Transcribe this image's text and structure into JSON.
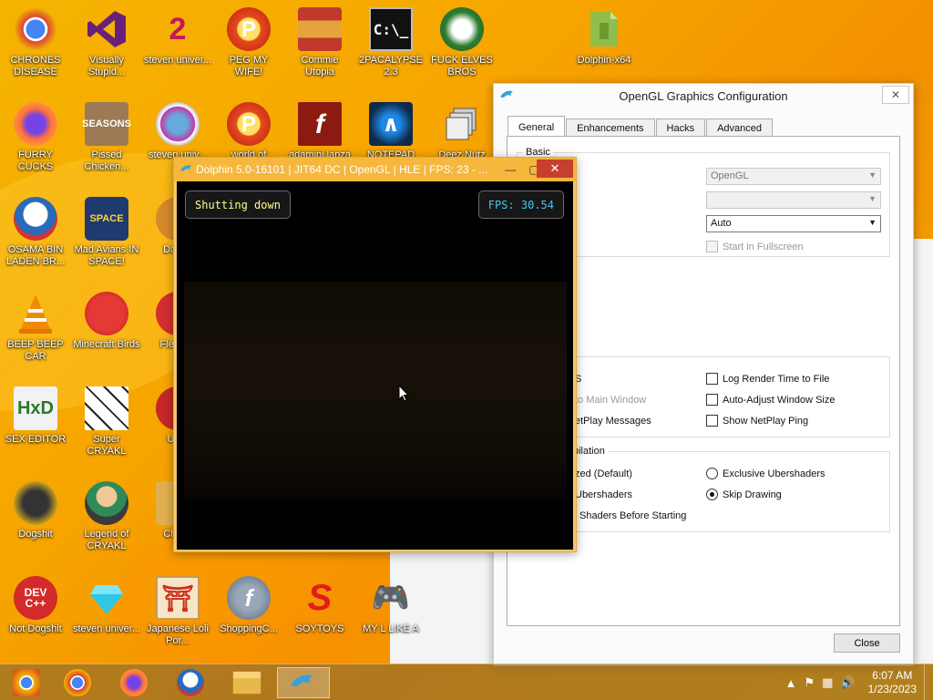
{
  "desktop": {
    "icons": [
      {
        "label": "CHRONES DISEASE",
        "icon": "chrome-icon"
      },
      {
        "label": "Visually Stupid...",
        "icon": "visual-studio-icon"
      },
      {
        "label": "steven univer...",
        "icon": "app-icon"
      },
      {
        "label": "PEG MY WIFE!",
        "icon": "peggle-icon"
      },
      {
        "label": "Commie Utopia",
        "icon": "game-icon"
      },
      {
        "label": "2PACALYPSE 2.3",
        "icon": "console-icon"
      },
      {
        "label": "FUCK ELVES BROS",
        "icon": "game-icon"
      },
      {
        "label": "Dolphin-x64",
        "icon": "folder-icon"
      },
      {
        "label": "FURRY CUCKS",
        "icon": "firefox-icon"
      },
      {
        "label": "Pissed Chicken...",
        "icon": "angry-birds-icon"
      },
      {
        "label": "steven univ...",
        "icon": "gem-icon"
      },
      {
        "label": "world of",
        "icon": "peggle-icon"
      },
      {
        "label": "adamini lanza",
        "icon": "flash-icon"
      },
      {
        "label": "NOTEPAD",
        "icon": "notepad-icon"
      },
      {
        "label": "Deez Nutz",
        "icon": "windows-icon"
      },
      {
        "label": "OSAMA BIN LADEN BR...",
        "icon": "obama-logo-icon"
      },
      {
        "label": "Mad Avians IN SPACE!",
        "icon": "angry-birds-space-icon"
      },
      {
        "label": "DarkO",
        "icon": "app-icon"
      },
      {
        "label": "BEEP BEEP CAR",
        "icon": "vlc-icon"
      },
      {
        "label": "Minecraft Birds",
        "icon": "angry-birds-icon"
      },
      {
        "label": "Fles DE",
        "icon": "app-icon"
      },
      {
        "label": "SEX EDITOR",
        "icon": "hxd-icon"
      },
      {
        "label": "Super CRYAKL",
        "icon": "pixel-cat-icon"
      },
      {
        "label": "UKR",
        "icon": "app-icon"
      },
      {
        "label": "Dogshit",
        "icon": "dev-cpp-icon"
      },
      {
        "label": "Legend of CRYAKL",
        "icon": "character-icon"
      },
      {
        "label": "Chi Dr",
        "icon": "folder-icon"
      },
      {
        "label": "Not Dogshit",
        "icon": "dev-cpp-icon"
      },
      {
        "label": "steven univer...",
        "icon": "diamond-icon"
      },
      {
        "label": "Japanese Loli Por...",
        "icon": "torii-icon"
      },
      {
        "label": "ShoppingC...",
        "icon": "flash-icon"
      },
      {
        "label": "SOYTOYS",
        "icon": "s-logo-icon"
      },
      {
        "label": "MY L LIKE A",
        "icon": "controller-icon"
      }
    ]
  },
  "gfx_window": {
    "title": "OpenGL Graphics Configuration",
    "tabs": [
      "General",
      "Enhancements",
      "Hacks",
      "Advanced"
    ],
    "basic_group": "Basic",
    "backend_value": "OpenGL",
    "adapter_value": "",
    "aspect_value": "Auto",
    "fullscreen_label": "Start in Fullscreen",
    "other_items": {
      "s_label": "S",
      "main_window_label": "to Main Window",
      "netplay_msgs_label": "etPlay Messages",
      "log_render_label": "Log Render Time to File",
      "auto_adjust_label": "Auto-Adjust Window Size",
      "netplay_ping_label": "Show NetPlay Ping"
    },
    "shader_group": "pilation",
    "shader_items": {
      "default_label": "zed (Default)",
      "ubershaders_label": "Ubershaders",
      "before_start_label": "Shaders Before Starting",
      "exclusive_label": "Exclusive Ubershaders",
      "skip_label": "Skip Drawing"
    },
    "close_label": "Close"
  },
  "dolphin_window": {
    "title": "Dolphin 5.0-16101 | JIT64 DC | OpenGL | HLE | FPS: 23 - ...",
    "osd_status": "Shutting down",
    "osd_fps": "FPS: 30.54"
  },
  "taskbar": {
    "items": [
      "chrome-canary-icon",
      "chrome-icon",
      "firefox-icon",
      "obama-logo-icon",
      "file-explorer-icon",
      "dolphin-icon"
    ],
    "time": "6:07 AM",
    "date": "1/23/2023"
  },
  "colors": {
    "desktop_bg": "#f7a500",
    "dolphin_frame": "#f6b73c",
    "close_red": "#c7402e",
    "osd_yellow": "#ffff8a",
    "osd_cyan": "#3ec8e8"
  }
}
